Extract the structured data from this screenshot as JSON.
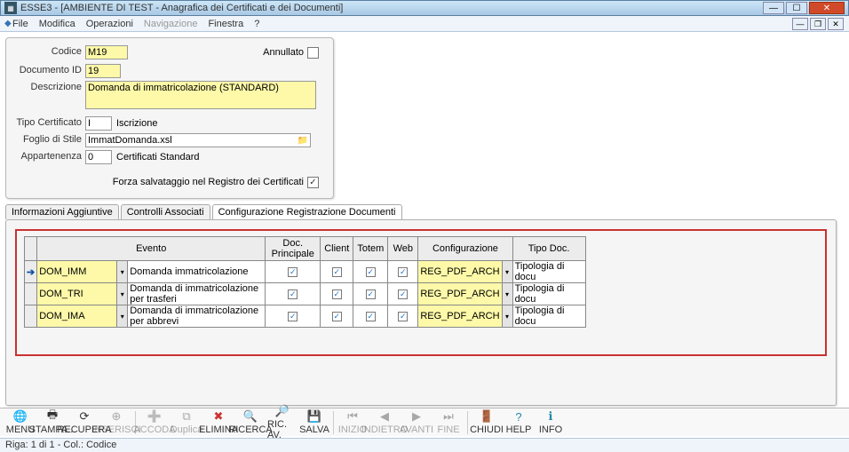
{
  "window": {
    "app_prefix": "ESSE3 -",
    "title_rest": "[AMBIENTE DI TEST - Anagrafica dei Certificati e dei Documenti]"
  },
  "menu": {
    "file": "File",
    "modifica": "Modifica",
    "operazioni": "Operazioni",
    "navigazione": "Navigazione",
    "finestra": "Finestra",
    "help": "?"
  },
  "form": {
    "lbl_codice": "Codice",
    "codice": "M19",
    "lbl_docid": "Documento ID",
    "docid": "19",
    "lbl_descr": "Descrizione",
    "descr": "Domanda di immatricolazione (STANDARD)",
    "lbl_annull": "Annullato",
    "annull_checked": false,
    "lbl_tipo": "Tipo Certificato",
    "tipo_code": "I",
    "tipo_label": "Iscrizione",
    "lbl_stile": "Foglio di Stile",
    "stile": "ImmatDomanda.xsl",
    "lbl_appart": "Appartenenza",
    "appart_code": "0",
    "appart_label": "Certificati Standard",
    "lbl_forza": "Forza salvataggio nel Registro dei Certificati"
  },
  "tabs": {
    "t1": "Informazioni Aggiuntive",
    "t2": "Controlli Associati",
    "t3": "Configurazione Registrazione Documenti"
  },
  "grid": {
    "h_evento": "Evento",
    "h_docprinc": "Doc. Principale",
    "h_client": "Client",
    "h_totem": "Totem",
    "h_web": "Web",
    "h_config": "Configurazione",
    "h_tipodoc": "Tipo Doc.",
    "rows": [
      {
        "code": "DOM_IMM",
        "desc": "Domanda immatricolazione",
        "dp": true,
        "cl": true,
        "to": true,
        "we": true,
        "conf": "REG_PDF_ARCH",
        "tipo": "Tipologia di docu"
      },
      {
        "code": "DOM_TRI",
        "desc": "Domanda di immatricolazione per trasferi",
        "dp": true,
        "cl": true,
        "to": true,
        "we": true,
        "conf": "REG_PDF_ARCH",
        "tipo": "Tipologia di docu"
      },
      {
        "code": "DOM_IMA",
        "desc": "Domanda di immatricolazione per abbrevi",
        "dp": true,
        "cl": true,
        "to": true,
        "we": true,
        "conf": "REG_PDF_ARCH",
        "tipo": "Tipologia di docu"
      }
    ]
  },
  "toolbar": {
    "menu": "MENU",
    "stampa": "STAMPA...",
    "recupera": "RECUPERA",
    "inserisci": "INSERISCI",
    "accoda": "ACCODA",
    "duplica": "Duplica",
    "elimina": "ELIMINA",
    "ricerca": "RICERCA",
    "ricav": "RIC. AV.",
    "salva": "SALVA",
    "inizio": "INIZIO",
    "indietro": "INDIETRO",
    "avanti": "AVANTI",
    "fine": "FINE",
    "chiudi": "CHIUDI",
    "help": "HELP",
    "info": "INFO"
  },
  "status": "Riga: 1 di 1 - Col.: Codice"
}
